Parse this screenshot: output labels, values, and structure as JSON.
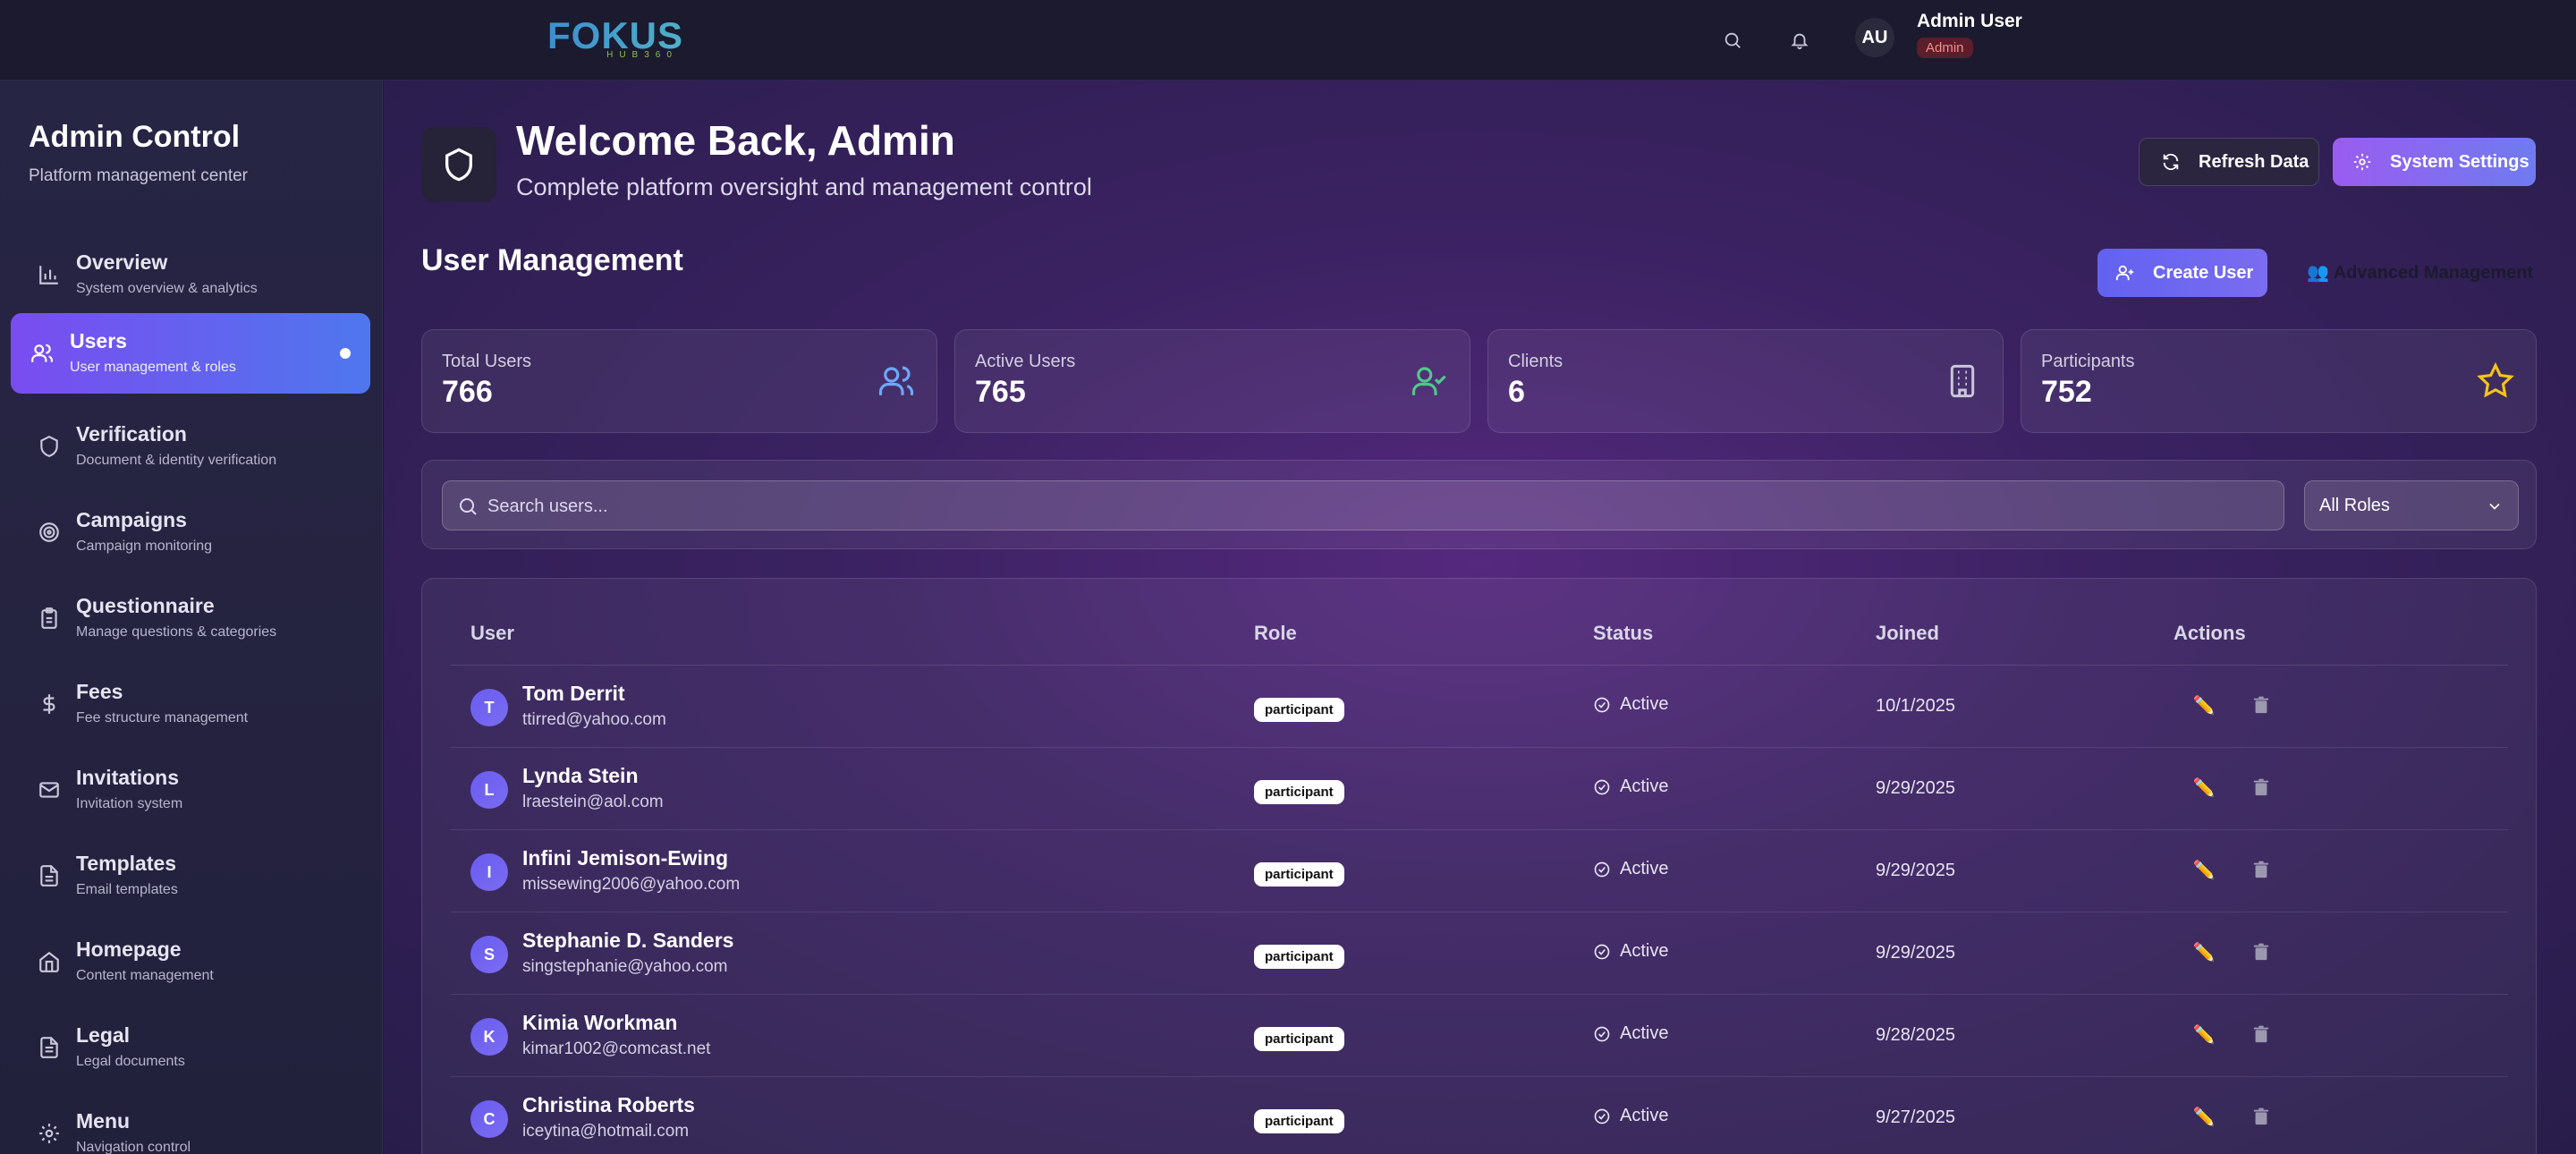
{
  "topbar": {
    "logo_text": "FOKUS",
    "logo_sub": "HUB360",
    "avatar_initials": "AU",
    "user_name": "Admin User",
    "user_role": "Admin"
  },
  "sidebar": {
    "title": "Admin Control",
    "subtitle": "Platform management center",
    "items": [
      {
        "label": "Overview",
        "desc": "System overview & analytics",
        "icon": "bar-chart-icon"
      },
      {
        "label": "Users",
        "desc": "User management & roles",
        "icon": "users-icon",
        "active": true
      },
      {
        "label": "Verification",
        "desc": "Document & identity verification",
        "icon": "shield-icon"
      },
      {
        "label": "Campaigns",
        "desc": "Campaign monitoring",
        "icon": "target-icon"
      },
      {
        "label": "Questionnaire",
        "desc": "Manage questions & categories",
        "icon": "clipboard-icon"
      },
      {
        "label": "Fees",
        "desc": "Fee structure management",
        "icon": "dollar-icon"
      },
      {
        "label": "Invitations",
        "desc": "Invitation system",
        "icon": "mail-icon"
      },
      {
        "label": "Templates",
        "desc": "Email templates",
        "icon": "file-icon"
      },
      {
        "label": "Homepage",
        "desc": "Content management",
        "icon": "home-icon"
      },
      {
        "label": "Legal",
        "desc": "Legal documents",
        "icon": "document-icon"
      },
      {
        "label": "Menu",
        "desc": "Navigation control",
        "icon": "gear-icon"
      }
    ]
  },
  "header": {
    "title": "Welcome Back, Admin",
    "subtitle": "Complete platform oversight and management control",
    "refresh_label": "Refresh Data",
    "settings_label": "System Settings"
  },
  "users_section": {
    "title": "User Management",
    "create_label": "Create User",
    "advanced_label": "👥 Advanced Management"
  },
  "stats": [
    {
      "label": "Total Users",
      "value": "766",
      "icon": "users-icon"
    },
    {
      "label": "Active Users",
      "value": "765",
      "icon": "user-check-icon"
    },
    {
      "label": "Clients",
      "value": "6",
      "icon": "building-icon"
    },
    {
      "label": "Participants",
      "value": "752",
      "icon": "star-icon"
    }
  ],
  "search": {
    "placeholder": "Search users...",
    "role_filter": "All Roles"
  },
  "table": {
    "columns": [
      "User",
      "Role",
      "Status",
      "Joined",
      "Actions"
    ],
    "rows": [
      {
        "initial": "T",
        "name": "Tom Derrit",
        "email": "ttirred@yahoo.com",
        "role": "participant",
        "status": "Active",
        "joined": "10/1/2025"
      },
      {
        "initial": "L",
        "name": "Lynda Stein",
        "email": "lraestein@aol.com",
        "role": "participant",
        "status": "Active",
        "joined": "9/29/2025"
      },
      {
        "initial": "I",
        "name": "Infini Jemison-Ewing",
        "email": "missewing2006@yahoo.com",
        "role": "participant",
        "status": "Active",
        "joined": "9/29/2025"
      },
      {
        "initial": "S",
        "name": "Stephanie D. Sanders",
        "email": "singstephanie@yahoo.com",
        "role": "participant",
        "status": "Active",
        "joined": "9/29/2025"
      },
      {
        "initial": "K",
        "name": "Kimia Workman",
        "email": "kimar1002@comcast.net",
        "role": "participant",
        "status": "Active",
        "joined": "9/28/2025"
      },
      {
        "initial": "C",
        "name": "Christina Roberts",
        "email": "iceytina@hotmail.com",
        "role": "participant",
        "status": "Active",
        "joined": "9/27/2025"
      }
    ],
    "edit_glyph": "✏️"
  },
  "colors": {
    "accent_gradient_start": "#7a4cf0",
    "accent_gradient_end": "#4f77ee",
    "active_check": "#e6e4f2",
    "admin_badge_bg": "#5a1f2b",
    "star": "#f5c518",
    "user_check": "#4ecb8a",
    "users_icon": "#6ea8ff",
    "building": "#c8c6d8"
  }
}
